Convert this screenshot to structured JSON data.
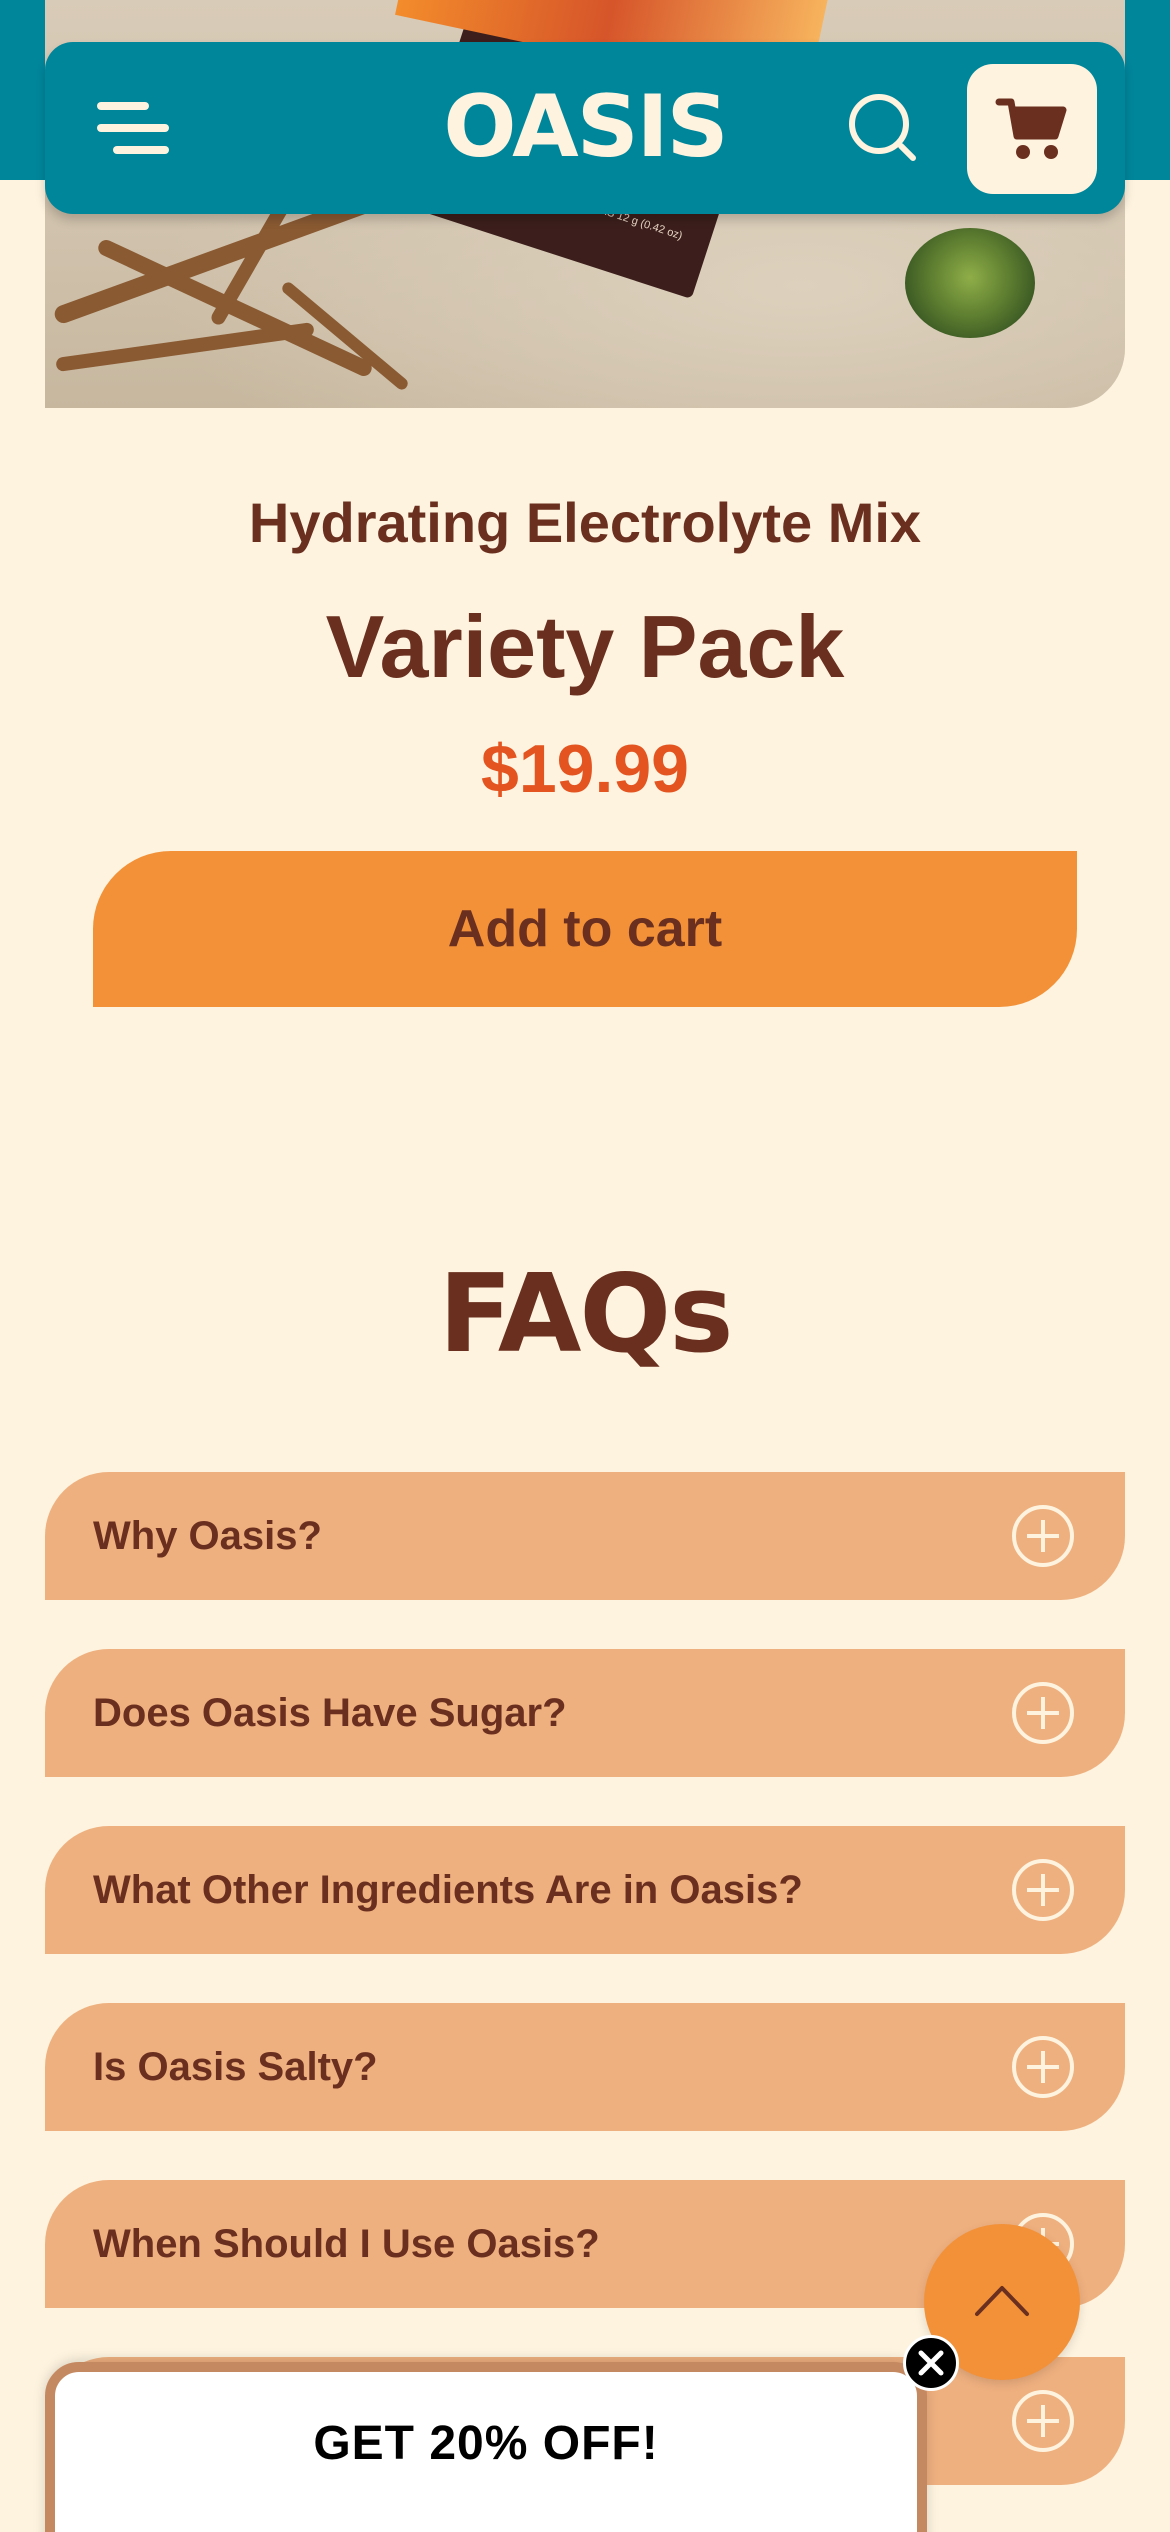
{
  "header": {
    "logo": "OASIS"
  },
  "hero": {
    "package_text": "6 STICKS 12 g (0.42 oz)"
  },
  "product": {
    "subtitle": "Hydrating Electrolyte Mix",
    "title": "Variety Pack",
    "price": "$19.99",
    "add_to_cart_label": "Add to cart"
  },
  "faq": {
    "title": "FAQs",
    "items": [
      {
        "question": "Why Oasis?"
      },
      {
        "question": "Does Oasis Have Sugar?"
      },
      {
        "question": "What Other Ingredients Are in Oasis?"
      },
      {
        "question": "Is Oasis Salty?"
      },
      {
        "question": "When Should I Use Oasis?"
      },
      {
        "question": ""
      }
    ]
  },
  "promo": {
    "text": "GET 20% OFF!"
  },
  "colors": {
    "teal": "#00869b",
    "cream": "#fdf3df",
    "brown": "#6b2f1f",
    "orange": "#f29138",
    "faq_bg": "#efb07f",
    "price": "#e35420"
  },
  "icons": [
    "menu-icon",
    "search-icon",
    "cart-icon",
    "plus-icon",
    "chevron-up-icon",
    "close-icon"
  ]
}
